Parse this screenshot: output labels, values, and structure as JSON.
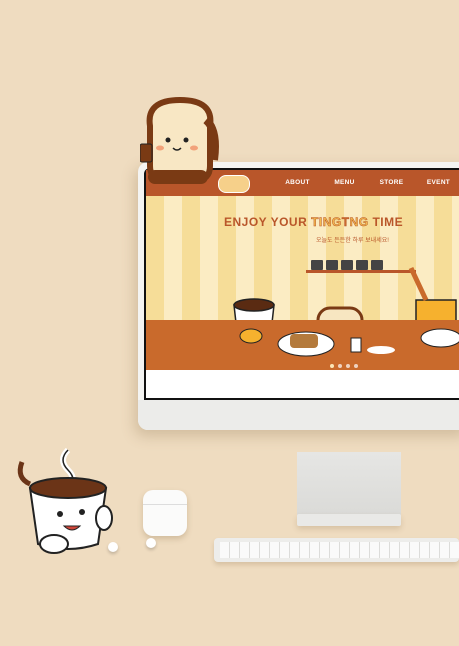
{
  "site": {
    "nav": [
      "ABOUT",
      "MENU",
      "STORE",
      "EVENT",
      "C"
    ],
    "headline_pre": "ENJOY YOUR ",
    "headline_ting1": "TING",
    "headline_ting2": "T",
    "headline_ting3": "NG",
    "headline_post": " TIME",
    "subline": "오늘도 든든한 하루 보내세요!"
  },
  "colors": {
    "background": "#efdcc0",
    "brand_brown": "#b9562a",
    "stripe_yellow": "#f6dd98",
    "table_orange": "#c96a2c"
  },
  "icons": [
    "toast-mascot-icon",
    "coffee-cup-mascot-icon",
    "juice-mascot-icon",
    "airpods-icon",
    "keyboard-icon"
  ]
}
